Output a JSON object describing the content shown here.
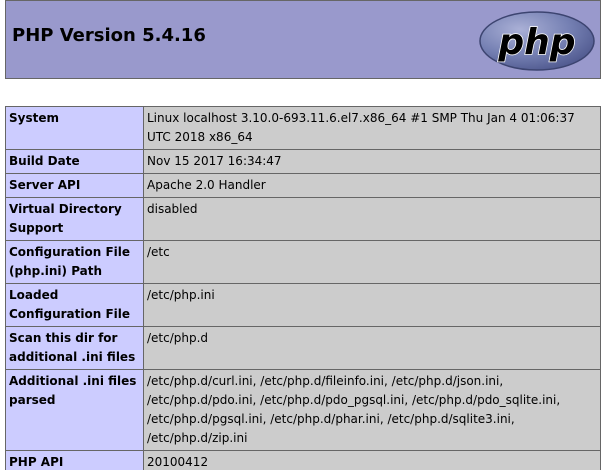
{
  "header": {
    "title": "PHP Version 5.4.16",
    "logo_text": "php",
    "logo_icon": "php-logo-icon"
  },
  "rows": [
    {
      "label": "System",
      "value": "Linux localhost 3.10.0-693.11.6.el7.x86_64 #1 SMP Thu Jan 4 01:06:37 UTC 2018 x86_64"
    },
    {
      "label": "Build Date",
      "value": "Nov 15 2017 16:34:47"
    },
    {
      "label": "Server API",
      "value": "Apache 2.0 Handler"
    },
    {
      "label": "Virtual Directory Support",
      "value": "disabled"
    },
    {
      "label": "Configuration File (php.ini) Path",
      "value": "/etc"
    },
    {
      "label": "Loaded Configuration File",
      "value": "/etc/php.ini"
    },
    {
      "label": "Scan this dir for additional .ini files",
      "value": "/etc/php.d"
    },
    {
      "label": "Additional .ini files parsed",
      "value": "/etc/php.d/curl.ini, /etc/php.d/fileinfo.ini, /etc/php.d/json.ini, /etc/php.d/pdo.ini, /etc/php.d/pdo_pgsql.ini, /etc/php.d/pdo_sqlite.ini, /etc/php.d/pgsql.ini, /etc/php.d/phar.ini, /etc/php.d/sqlite3.ini, /etc/php.d/zip.ini"
    },
    {
      "label": "PHP API",
      "value": "20100412"
    }
  ],
  "colors": {
    "header_bg": "#9999cc",
    "label_bg": "#ccccff",
    "value_bg": "#cccccc",
    "border": "#666666",
    "logo_bg": "#6d77a6"
  }
}
